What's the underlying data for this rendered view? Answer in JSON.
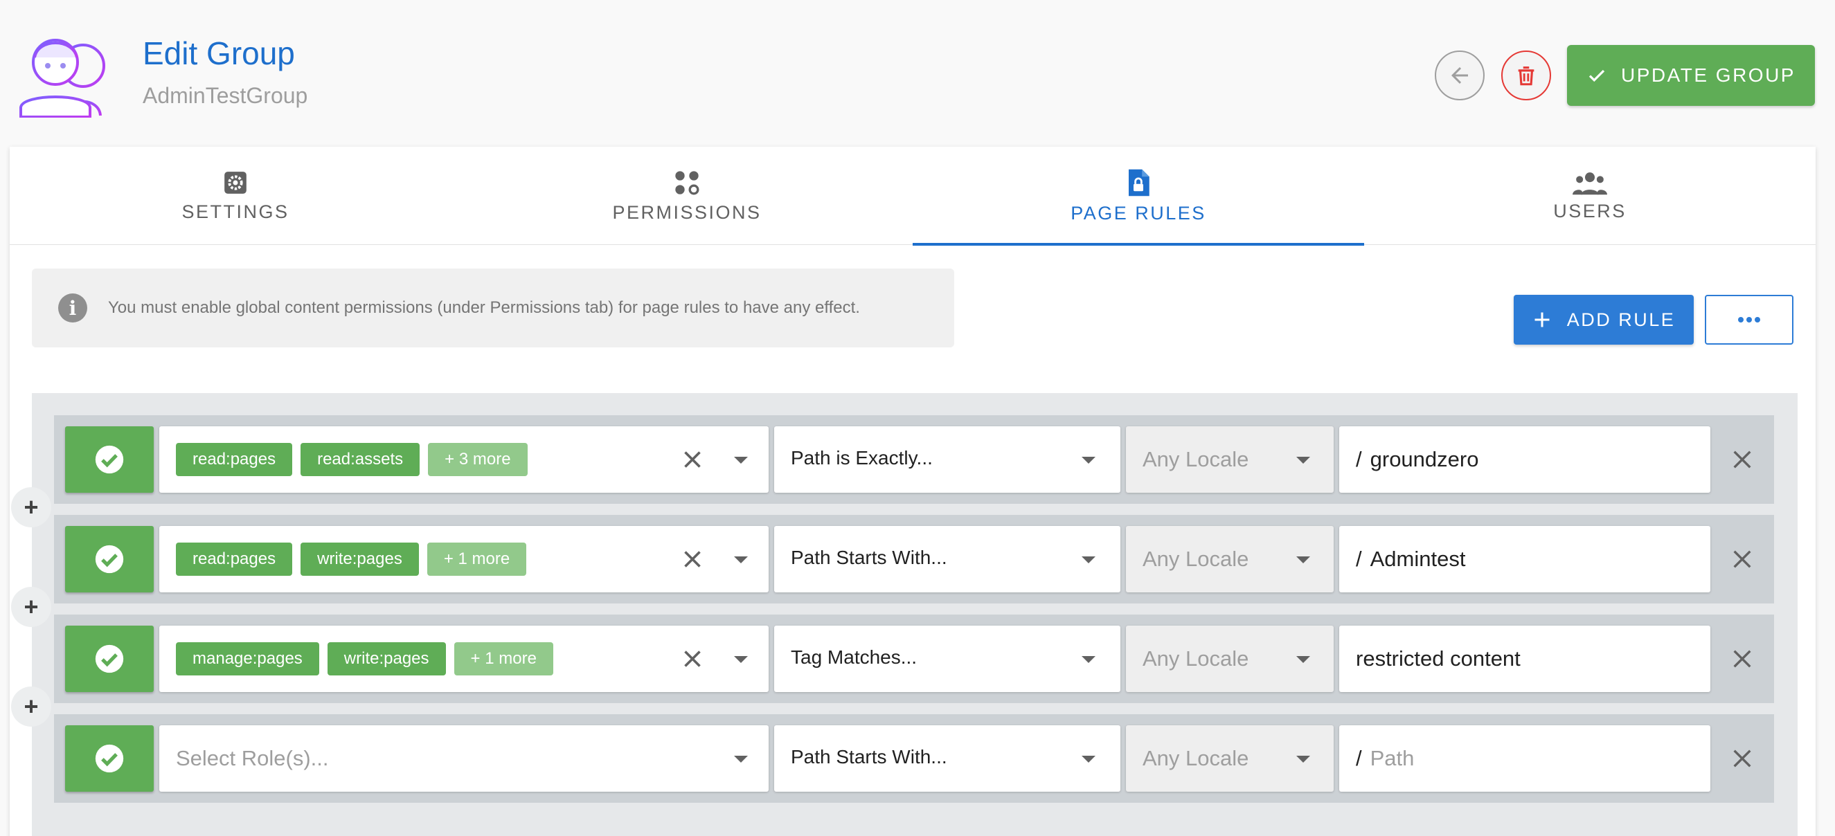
{
  "header": {
    "title": "Edit Group",
    "subtitle": "AdminTestGroup",
    "update_label": "UPDATE GROUP"
  },
  "tabs": [
    {
      "label": "SETTINGS",
      "icon": "gear-icon",
      "active": false
    },
    {
      "label": "PERMISSIONS",
      "icon": "permissions-icon",
      "active": false
    },
    {
      "label": "PAGE RULES",
      "icon": "file-lock-icon",
      "active": true
    },
    {
      "label": "USERS",
      "icon": "users-icon",
      "active": false
    }
  ],
  "notice": {
    "text": "You must enable global content permissions (under Permissions tab) for page rules to have any effect."
  },
  "actions": {
    "add_rule_label": "ADD RULE"
  },
  "rules": [
    {
      "roles": [
        "read:pages",
        "read:assets"
      ],
      "more": "+ 3 more",
      "placeholder": "",
      "match": "Path is Exactly...",
      "locale": "Any Locale",
      "path_prefix": "/",
      "path": "groundzero"
    },
    {
      "roles": [
        "read:pages",
        "write:pages"
      ],
      "more": "+ 1 more",
      "placeholder": "",
      "match": "Path Starts With...",
      "locale": "Any Locale",
      "path_prefix": "/",
      "path": "Admintest"
    },
    {
      "roles": [
        "manage:pages",
        "write:pages"
      ],
      "more": "+ 1 more",
      "placeholder": "",
      "match": "Tag Matches...",
      "locale": "Any Locale",
      "path_prefix": "",
      "path": "restricted content"
    },
    {
      "roles": [],
      "more": "",
      "placeholder": "Select Role(s)...",
      "match": "Path Starts With...",
      "locale": "Any Locale",
      "path_prefix": "/",
      "path": "",
      "path_placeholder": "Path"
    }
  ],
  "insert_symbol": "+",
  "colors": {
    "primary": "#1e6fcc",
    "success": "#5fad56",
    "danger": "#e53935"
  }
}
